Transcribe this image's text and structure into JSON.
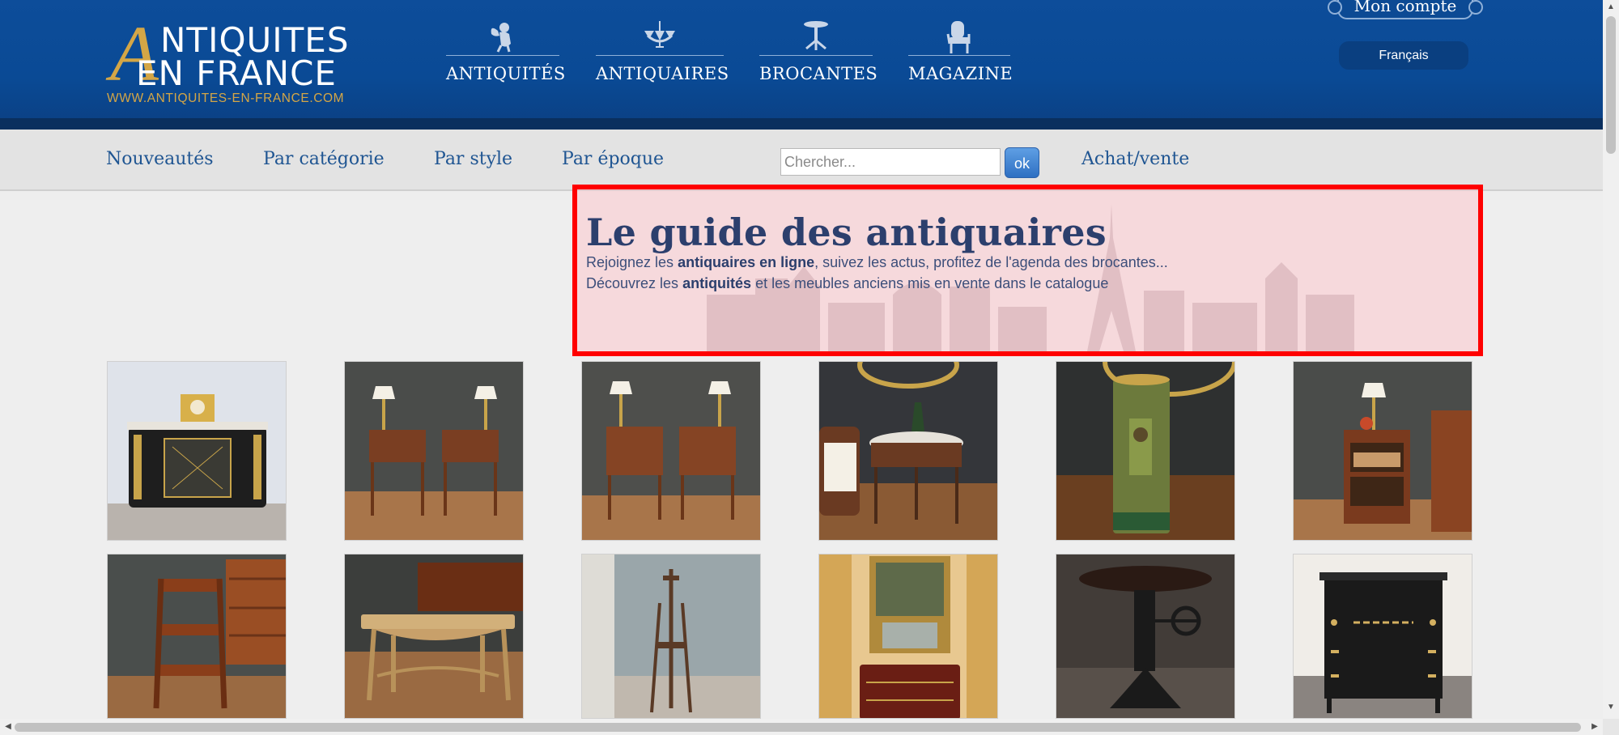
{
  "header": {
    "logo": {
      "initial": "A",
      "line1": "NTIQUITES",
      "line2": "EN FRANCE",
      "url": "WWW.ANTIQUITES-EN-FRANCE.COM"
    },
    "nav": [
      {
        "label": "ANTIQUITÉS",
        "icon": "cherub-icon"
      },
      {
        "label": "ANTIQUAIRES",
        "icon": "chandelier-icon"
      },
      {
        "label": "BROCANTES",
        "icon": "pedestal-table-icon"
      },
      {
        "label": "MAGAZINE",
        "icon": "armchair-icon"
      }
    ],
    "account_label": "Mon compte",
    "language_label": "Français"
  },
  "subnav": {
    "links": [
      "Nouveautés",
      "Par catégorie",
      "Par style",
      "Par époque"
    ],
    "search_placeholder": "Chercher...",
    "search_button": "ok",
    "buy_sell": "Achat/vente"
  },
  "hero": {
    "title": "Le guide des antiquaires",
    "line1_pre": "Rejoignez les ",
    "line1_bold": "antiquaires en ligne",
    "line1_post": ", suivez les actus, profitez de l'agenda des brocantes...",
    "line2_pre": "Découvrez les ",
    "line2_bold": "antiquités",
    "line2_post": " et les meubles anciens mis en vente dans le catalogue"
  },
  "products": [
    {
      "name": "boulle-cabinet-with-clock",
      "kind": "cabinet"
    },
    {
      "name": "pair-of-nightstands-with-lamps",
      "kind": "nightstands"
    },
    {
      "name": "pair-of-nightstands",
      "kind": "nightstands"
    },
    {
      "name": "round-marble-side-table",
      "kind": "round-table"
    },
    {
      "name": "painted-umbrella-stand",
      "kind": "vase"
    },
    {
      "name": "bookcase-nightstand",
      "kind": "bookcase"
    },
    {
      "name": "library-step-ladder",
      "kind": "ladder"
    },
    {
      "name": "carved-oak-table",
      "kind": "table"
    },
    {
      "name": "wooden-easel",
      "kind": "easel"
    },
    {
      "name": "painted-trumeau-mirror-with-commode",
      "kind": "painting"
    },
    {
      "name": "industrial-crank-table",
      "kind": "pedestal"
    },
    {
      "name": "black-secretary-desk",
      "kind": "black-desk"
    }
  ]
}
